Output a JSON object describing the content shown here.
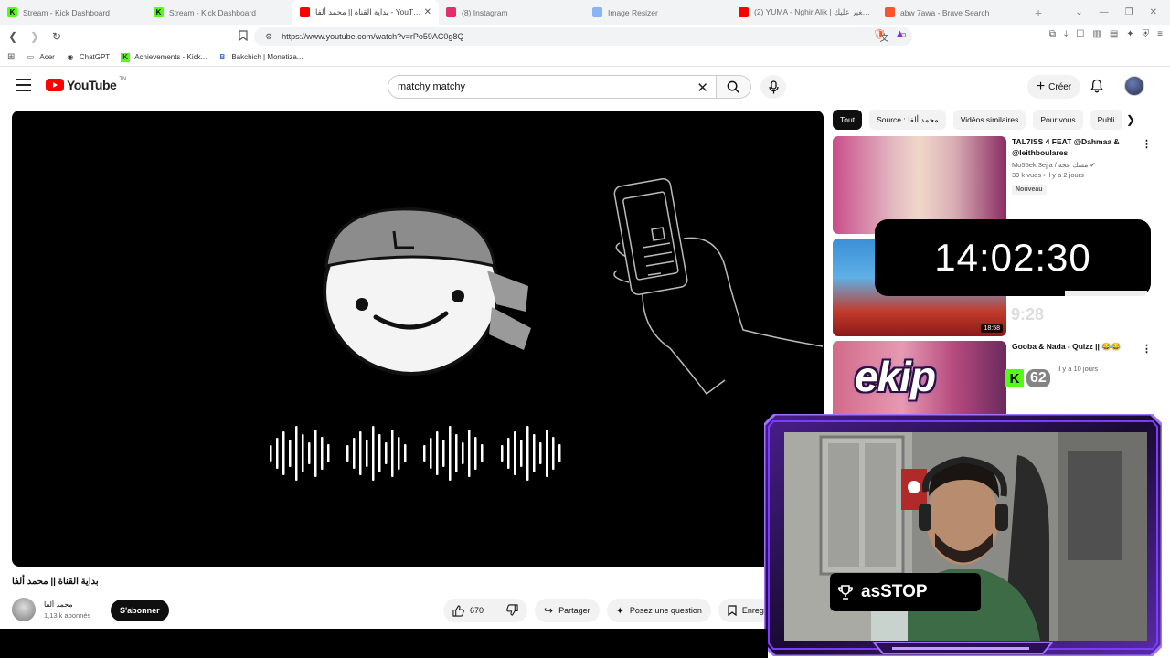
{
  "browser": {
    "tabs": [
      {
        "title": "Stream - Kick Dashboard",
        "icon": "kick-icon",
        "color": "#53fc18",
        "active": false
      },
      {
        "title": "Stream - Kick Dashboard",
        "icon": "kick-icon",
        "color": "#53fc18",
        "active": false
      },
      {
        "title": "بداية القناة || محمد ألفا - YouTube",
        "icon": "youtube-icon",
        "color": "#ff0000",
        "active": true
      },
      {
        "title": "(8) Instagram",
        "icon": "instagram-icon",
        "color": "#e1306c",
        "active": false
      },
      {
        "title": "Image Resizer",
        "icon": "image-icon",
        "color": "#8ab4f8",
        "active": false
      },
      {
        "title": "(2) YUMA - Nghir Alik | نغير عليك (C",
        "icon": "youtube-icon",
        "color": "#ff0000",
        "active": false
      },
      {
        "title": "abw 7awa - Brave Search",
        "icon": "brave-icon",
        "color": "#fb542b",
        "active": false
      }
    ],
    "url": "https://www.youtube.com/watch?v=rPo59AC0g8Q",
    "bookmarks": [
      {
        "label": "Acer",
        "icon": "folder-icon"
      },
      {
        "label": "ChatGPT",
        "icon": "chatgpt-icon"
      },
      {
        "label": "Achievements - Kick...",
        "icon": "kick-icon"
      },
      {
        "label": "Bakchich | Monetiza...",
        "icon": "bakchich-icon"
      }
    ]
  },
  "youtube": {
    "logo_text": "YouTube",
    "logo_tn": "TN",
    "search_value": "matchy matchy",
    "create_label": "Créer",
    "chips": [
      "Tout",
      "Source : محمد ألفا",
      "Vidéos similaires",
      "Pour vous",
      "Publi"
    ],
    "video": {
      "title": "بداية القناة || محمد ألفا",
      "channel": "محمد ألفا",
      "subscribers": "1,13 k abonnés",
      "subscribe_label": "S'abonner",
      "likes": "670",
      "share_label": "Partager",
      "ask_label": "Posez une question",
      "save_label": "Enreg"
    },
    "recommendations": [
      {
        "title": "TAL7ISS 4 FEAT @Dahmaa & @leithboulares",
        "channel": "Mo55ek 3ejja / مسك عجة",
        "meta": "39 k vues • il y a 2 jours",
        "badge": "Nouveau",
        "duration": ""
      },
      {
        "title": "",
        "channel": "",
        "meta": "",
        "badge": "",
        "duration": "18:58"
      },
      {
        "title": "Gooba & Nada - Quizz || 😂😂",
        "channel": "",
        "meta": "il y a 10 jours",
        "badge": "",
        "duration": ""
      }
    ]
  },
  "overlay": {
    "clock": "14:02:30",
    "ghost_time": "9:28",
    "brand": "ekip",
    "kick_count": "62",
    "follower_name": "asSTOP"
  },
  "colors": {
    "kick_green": "#53fc18",
    "youtube_red": "#ff0000",
    "frame_purple": "#7a3cff"
  }
}
